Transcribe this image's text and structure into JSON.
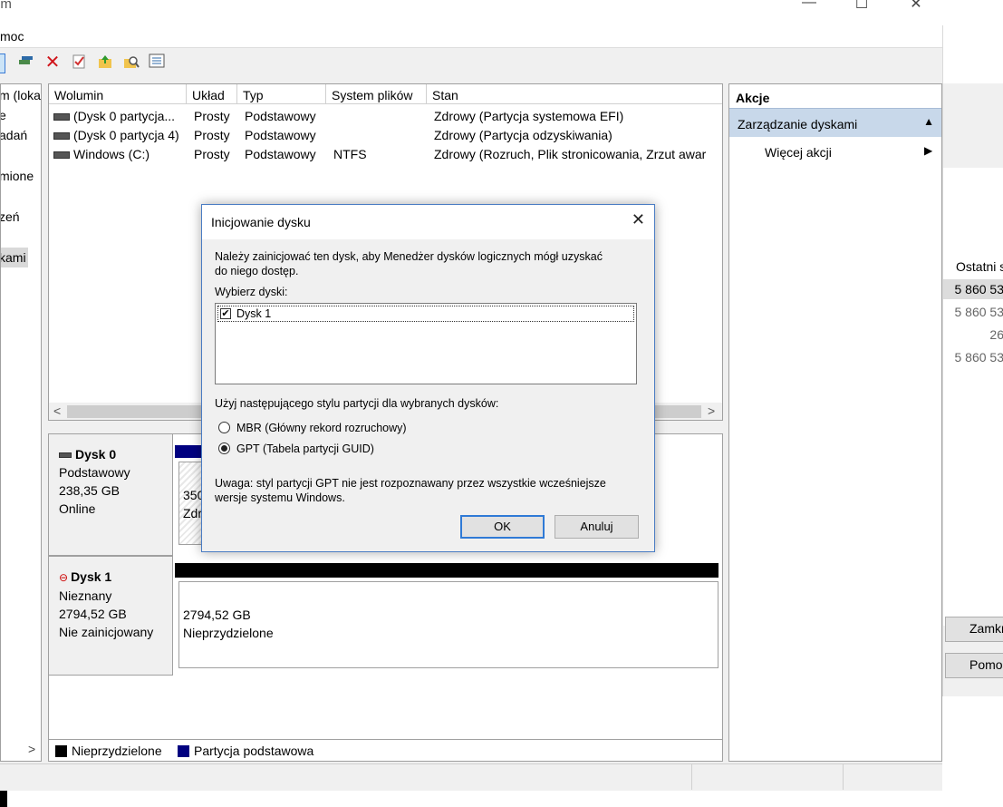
{
  "window": {
    "title_fragment": "em",
    "menu_help": "moc",
    "controls": {
      "minimize": "—",
      "maximize": "☐",
      "close": "✕"
    }
  },
  "left_pane": {
    "items": [
      "m (lokal",
      "e",
      "adań",
      "mione",
      "zeń",
      "kami"
    ],
    "scroll_right": ">"
  },
  "volumes": {
    "columns": [
      "Wolumin",
      "Układ",
      "Typ",
      "System plików",
      "Stan"
    ],
    "rows": [
      {
        "name": "(Dysk 0 partycja...",
        "layout": "Prosty",
        "type": "Podstawowy",
        "fs": "",
        "status": "Zdrowy (Partycja systemowa EFI)"
      },
      {
        "name": "(Dysk 0 partycja 4)",
        "layout": "Prosty",
        "type": "Podstawowy",
        "fs": "",
        "status": "Zdrowy (Partycja odzyskiwania)"
      },
      {
        "name": "Windows (C:)",
        "layout": "Prosty",
        "type": "Podstawowy",
        "fs": "NTFS",
        "status": "Zdrowy (Rozruch, Plik stronicowania, Zrzut awar"
      }
    ]
  },
  "disks": {
    "disk0": {
      "name": "Dysk 0",
      "kind": "Podstawowy",
      "size": "238,35 GB",
      "state": "Online",
      "part_size": "350",
      "part_state": "Zdr"
    },
    "disk1": {
      "name": "Dysk 1",
      "kind": "Nieznany",
      "size": "2794,52 GB",
      "state": "Nie zainicjowany",
      "part_size": "2794,52 GB",
      "part_state": "Nieprzydzielone"
    }
  },
  "legend": {
    "unallocated": "Nieprzydzielone",
    "primary": "Partycja podstawowa",
    "unallocated_color": "#000000",
    "primary_color": "#000080"
  },
  "actions": {
    "title": "Akcje",
    "section": "Zarządzanie dyskami",
    "more": "Więcej akcji"
  },
  "background_window": {
    "column_header": "Ostatni s",
    "cells": [
      "5 860 53",
      "5 860 53",
      "26",
      "5 860 53"
    ],
    "buttons": [
      "Zamkn",
      "Pomo"
    ]
  },
  "dialog": {
    "title": "Inicjowanie dysku",
    "description_line1": "Należy zainicjować ten dysk, aby Menedżer dysków logicznych mógł uzyskać",
    "description_line2": "do niego dostęp.",
    "select_label": "Wybierz dyski:",
    "disk_item": "Dysk 1",
    "disk_checked": true,
    "style_label": "Użyj następującego stylu partycji dla wybranych dysków:",
    "option_mbr": "MBR (Główny rekord rozruchowy)",
    "option_gpt": "GPT (Tabela partycji GUID)",
    "selected_option": "GPT",
    "note_line1": "Uwaga: styl partycji GPT nie jest rozpoznawany przez wszystkie wcześniejsze",
    "note_line2": "wersje systemu Windows.",
    "ok": "OK",
    "cancel": "Anuluj"
  }
}
